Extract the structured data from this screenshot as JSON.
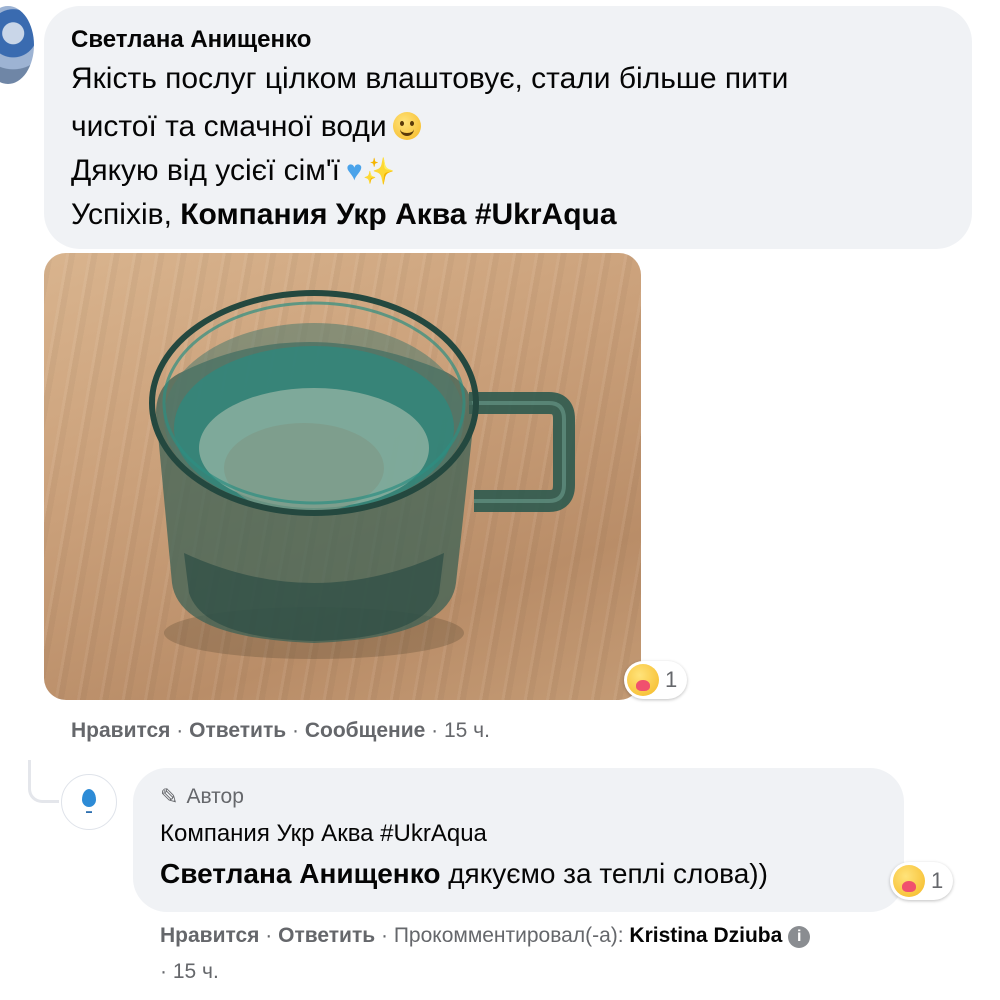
{
  "comment": {
    "author": "Светлана Анищенко",
    "line1": "Якість послуг цілком влаштовує, стали більше пити",
    "line2": "чистої та смачної води",
    "line3": "Дякую від усієї сім'ї",
    "line4_prefix": "Успіхів, ",
    "line4_tag": "Компания Укр Аква #UkrAqua",
    "emojis": [
      "smile-emoji",
      "blue-heart-emoji",
      "sparkles-emoji"
    ],
    "photo_icon": "green-glass-mug-photo",
    "reaction_count": "1",
    "actions": {
      "like": "Нравится",
      "reply": "Ответить",
      "message": "Сообщение",
      "sep": " · ",
      "time": "15 ч."
    }
  },
  "reply": {
    "badge": "Автор",
    "author": "Компания Укр Аква #UkrAqua",
    "mention": "Светлана Анищенко",
    "text": " дякуємо за теплі слова))",
    "reaction_count": "1",
    "actions": {
      "like": "Нравится",
      "reply": "Ответить",
      "commented_by": "Прокомментировал(-а): ",
      "commenter": "Kristina Dziuba",
      "sep": " · ",
      "info": "i",
      "time": "· 15 ч."
    }
  },
  "colors": {
    "bubble": "#f0f2f5",
    "meta_text": "#65676b",
    "water_teal": "#1f8f86",
    "glass": "#2f5a50"
  }
}
